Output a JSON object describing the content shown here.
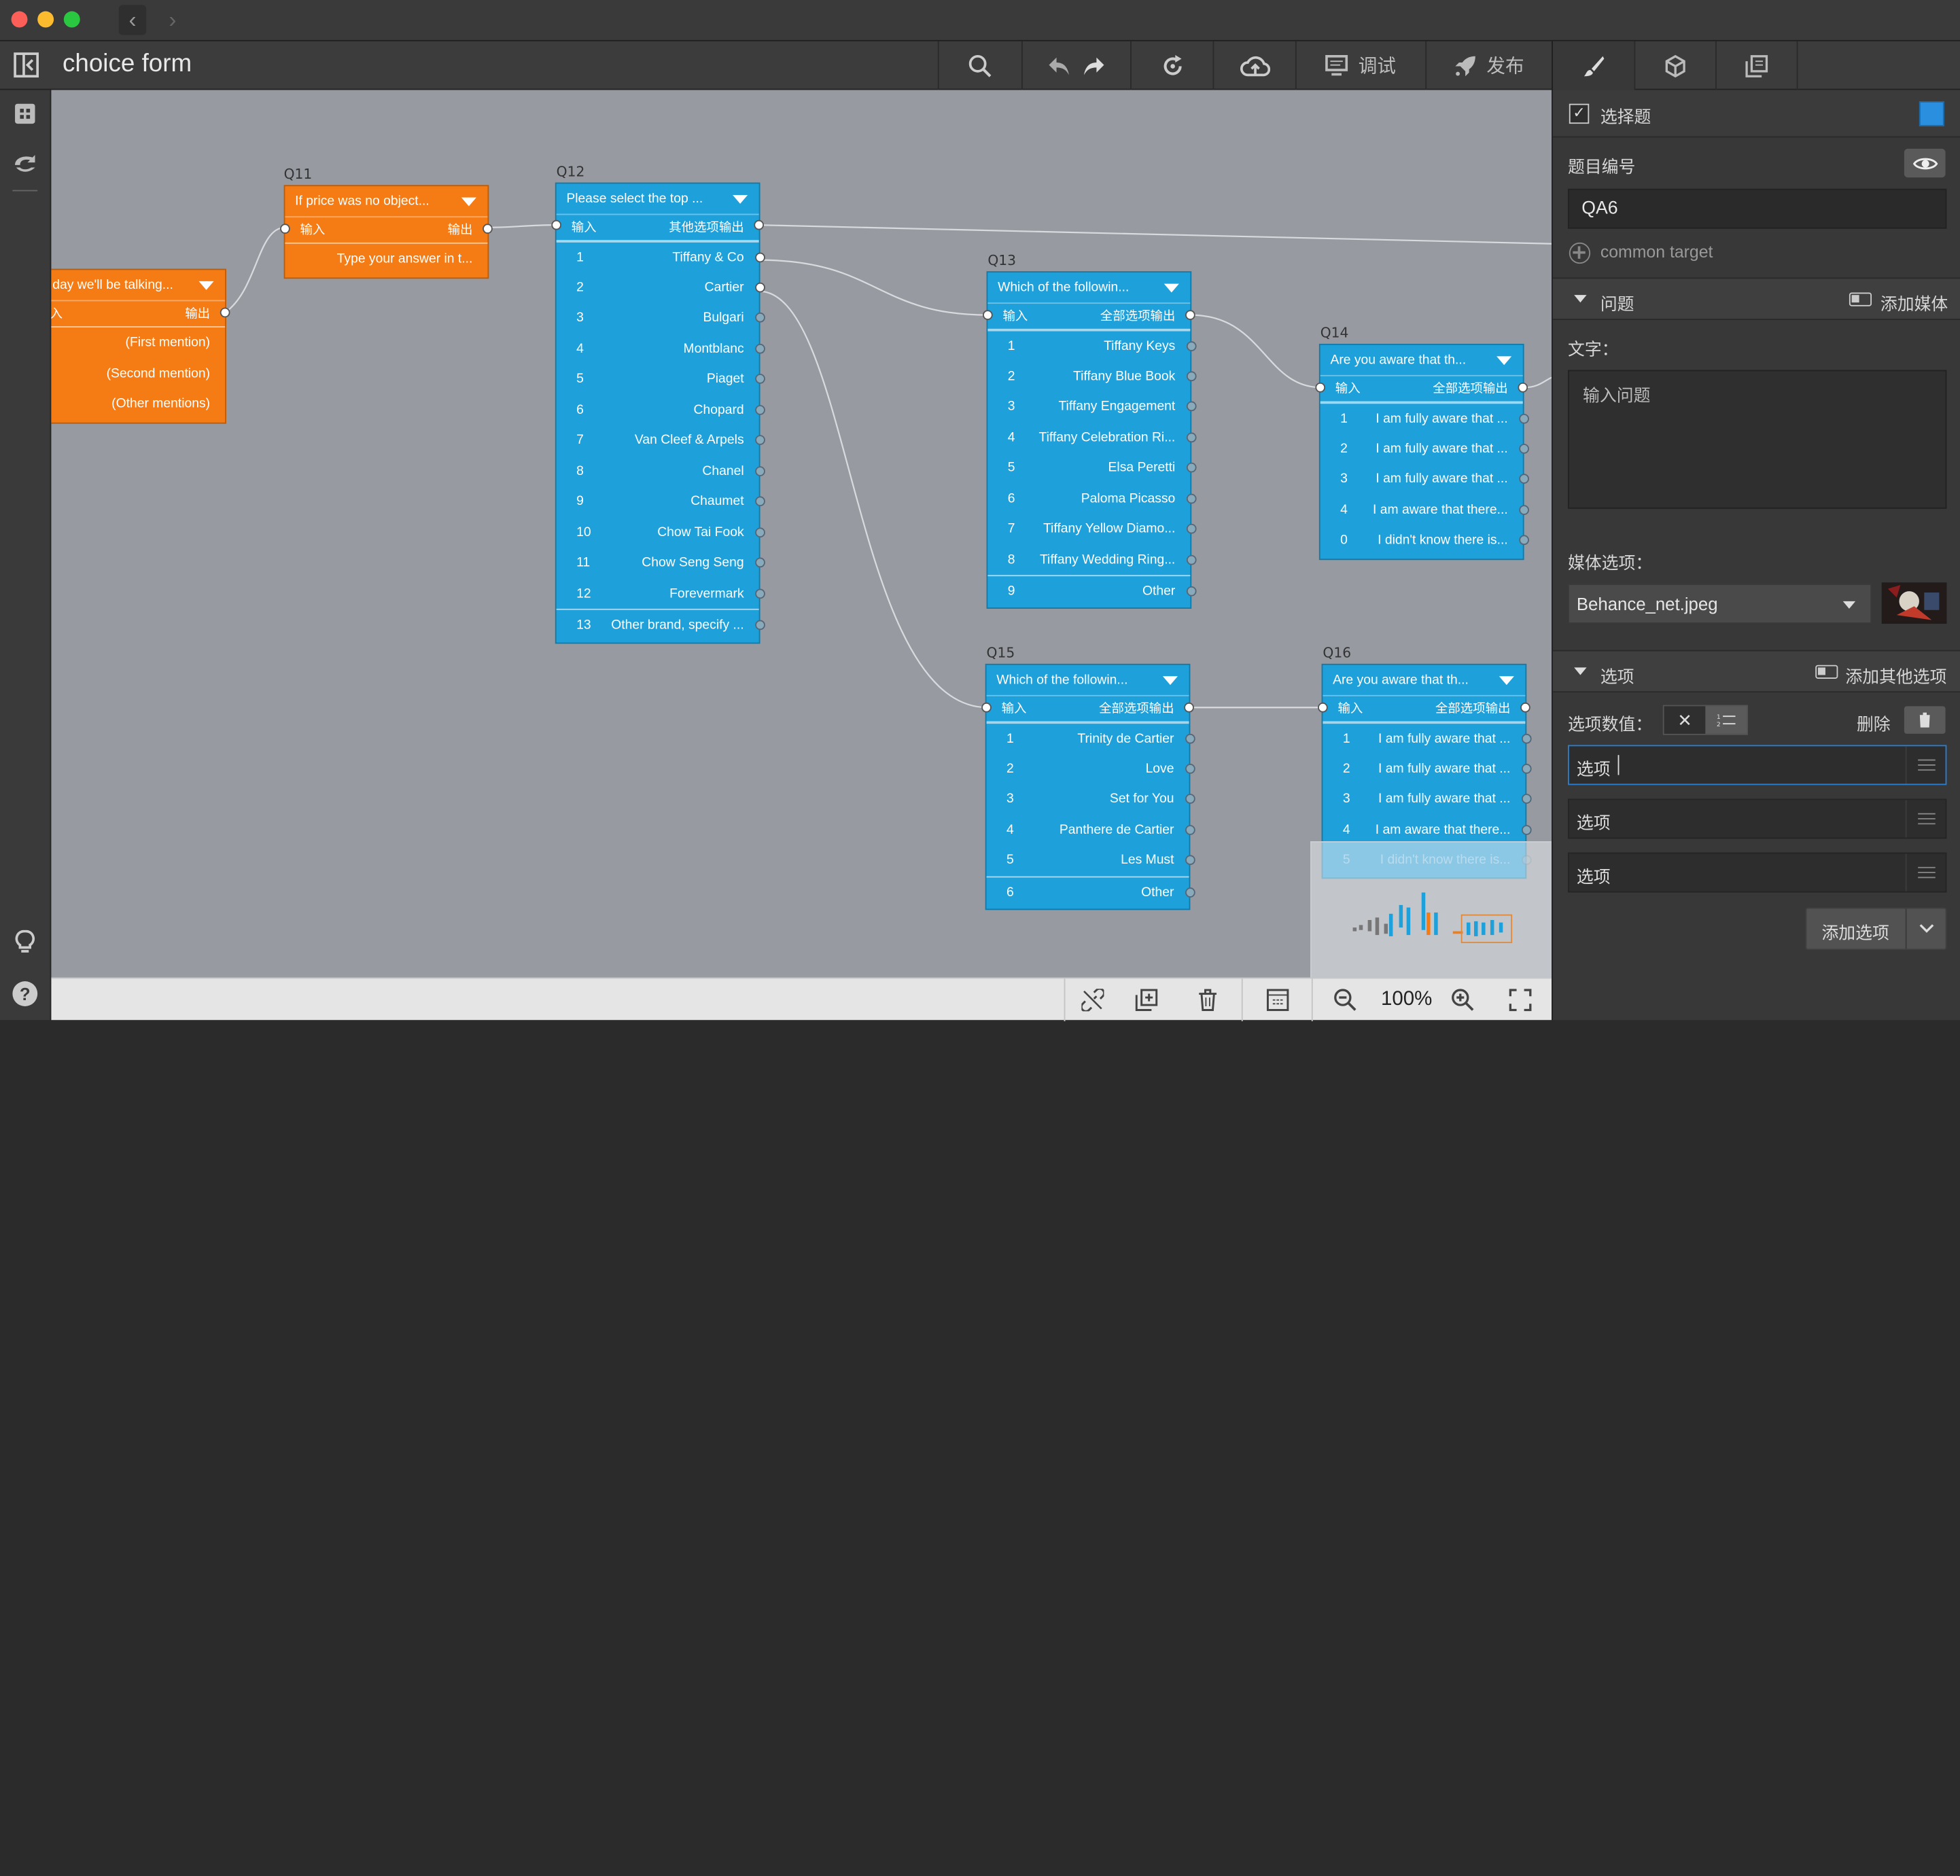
{
  "app": {
    "title": "choice form"
  },
  "toolbar": {
    "debug_label": "调试",
    "publish_label": "发布"
  },
  "canvas": {
    "zoom": "100%"
  },
  "nodes": {
    "q10": {
      "title": "day we'll be talking...",
      "in": "入",
      "out": "输出",
      "rows": [
        "(First mention)",
        "(Second mention)",
        "(Other mentions)"
      ]
    },
    "q11": {
      "label": "Q11",
      "title": "If price was no object...",
      "in": "输入",
      "out": "输出",
      "row": "Type your answer in t..."
    },
    "q12": {
      "label": "Q12",
      "title": "Please select the top ...",
      "in": "输入",
      "out": "其他选项输出",
      "rows": [
        [
          "1",
          "Tiffany & Co"
        ],
        [
          "2",
          "Cartier"
        ],
        [
          "3",
          "Bulgari"
        ],
        [
          "4",
          "Montblanc"
        ],
        [
          "5",
          "Piaget"
        ],
        [
          "6",
          "Chopard"
        ],
        [
          "7",
          "Van Cleef & Arpels"
        ],
        [
          "8",
          "Chanel"
        ],
        [
          "9",
          "Chaumet"
        ],
        [
          "10",
          "Chow Tai Fook"
        ],
        [
          "11",
          "Chow Seng Seng"
        ],
        [
          "12",
          "Forevermark"
        ]
      ],
      "extra": [
        "13",
        "Other brand, specify ..."
      ]
    },
    "q13": {
      "label": "Q13",
      "title": "Which of the followin...",
      "in": "输入",
      "out": "全部选项输出",
      "rows": [
        [
          "1",
          "Tiffany Keys"
        ],
        [
          "2",
          "Tiffany Blue Book"
        ],
        [
          "3",
          "Tiffany Engagement"
        ],
        [
          "4",
          "Tiffany Celebration Ri..."
        ],
        [
          "5",
          "Elsa Peretti"
        ],
        [
          "6",
          "Paloma Picasso"
        ],
        [
          "7",
          "Tiffany Yellow Diamo..."
        ],
        [
          "8",
          "Tiffany Wedding Ring..."
        ]
      ],
      "extra": [
        "9",
        "Other"
      ]
    },
    "q14": {
      "label": "Q14",
      "title": "Are you aware that th...",
      "in": "输入",
      "out": "全部选项输出",
      "rows": [
        [
          "1",
          "I am fully aware that ..."
        ],
        [
          "2",
          "I am fully aware that ..."
        ],
        [
          "3",
          "I am fully aware that ..."
        ],
        [
          "4",
          "I am aware that there..."
        ],
        [
          "0",
          "I didn't know there is..."
        ]
      ]
    },
    "q15": {
      "label": "Q15",
      "title": "Which of the followin...",
      "in": "输入",
      "out": "全部选项输出",
      "rows": [
        [
          "1",
          "Trinity de Cartier"
        ],
        [
          "2",
          "Love"
        ],
        [
          "3",
          "Set for You"
        ],
        [
          "4",
          "Panthere de Cartier"
        ],
        [
          "5",
          "Les Must"
        ]
      ],
      "extra": [
        "6",
        "Other"
      ]
    },
    "q16": {
      "label": "Q16",
      "title": "Are you aware that th...",
      "in": "输入",
      "out": "全部选项输出",
      "rows": [
        [
          "1",
          "I am fully aware that ..."
        ],
        [
          "2",
          "I am fully aware that ..."
        ],
        [
          "3",
          "I am fully aware that ..."
        ],
        [
          "4",
          "I am aware that there..."
        ],
        [
          "5",
          "I didn't know there is..."
        ]
      ]
    }
  },
  "panel": {
    "type_label": "选择题",
    "accent_color": "#2a8fde",
    "qid_label": "题目编号",
    "qid_value": "QA6",
    "common_target": "common target",
    "question_section": "问题",
    "add_media": "添加媒体",
    "text_label": "文字：",
    "question_placeholder": "输入问题",
    "media_label": "媒体选项：",
    "media_value": "Behance_net.jpeg",
    "options_section": "选项",
    "add_other": "添加其他选项",
    "option_value_label": "选项数值：",
    "delete_label": "删除",
    "options": [
      "选项",
      "选项",
      "选项"
    ],
    "add_option": "添加选项"
  }
}
